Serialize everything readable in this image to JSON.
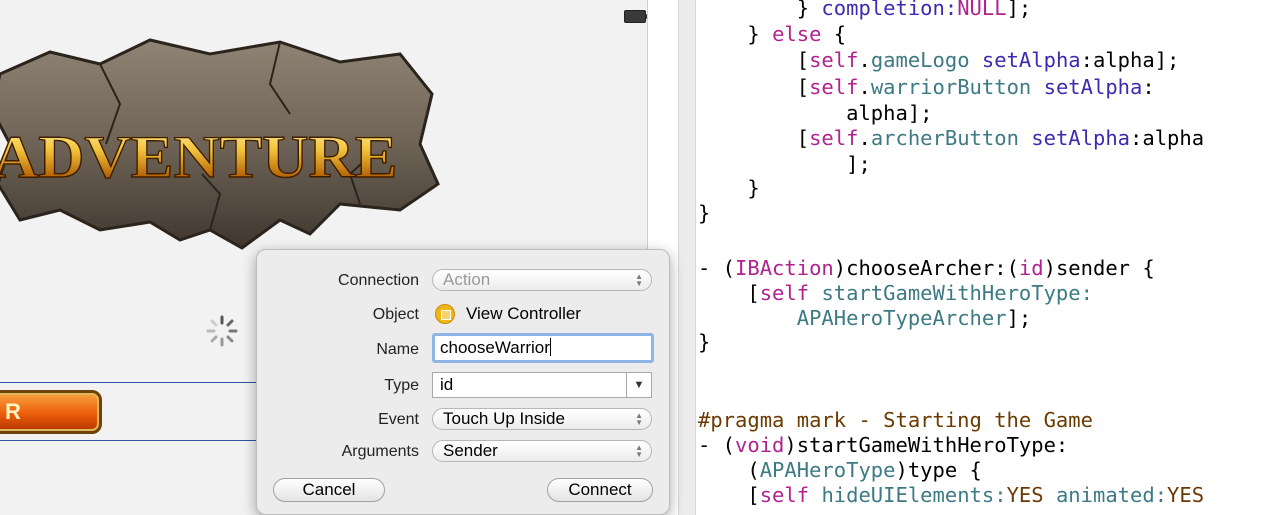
{
  "canvas": {
    "logo_text": "ADVENTURE",
    "warrior_button_label": "R"
  },
  "popover": {
    "connection": {
      "label": "Connection",
      "value": "Action"
    },
    "object": {
      "label": "Object",
      "value": "View Controller"
    },
    "name": {
      "label": "Name",
      "value": "chooseWarrior"
    },
    "type": {
      "label": "Type",
      "value": "id"
    },
    "event": {
      "label": "Event",
      "value": "Touch Up Inside"
    },
    "arguments": {
      "label": "Arguments",
      "value": "Sender"
    },
    "cancel_label": "Cancel",
    "connect_label": "Connect"
  },
  "code": {
    "l1": {
      "a": "        } ",
      "b": "completion:",
      "c": "NULL",
      "d": "];"
    },
    "l2": {
      "a": "    } ",
      "b": "else",
      "c": " {"
    },
    "l3": {
      "a": "        [",
      "b": "self",
      "c": ".",
      "d": "gameLogo",
      "e": " ",
      "f": "setAlpha",
      "g": ":alpha];"
    },
    "l4": {
      "a": "        [",
      "b": "self",
      "c": ".",
      "d": "warriorButton",
      "e": " ",
      "f": "setAlpha",
      "g": ":"
    },
    "l5": {
      "a": "            alpha];"
    },
    "l6": {
      "a": "        [",
      "b": "self",
      "c": ".",
      "d": "archerButton",
      "e": " ",
      "f": "setAlpha",
      "g": ":alpha"
    },
    "l7": {
      "a": "            ];"
    },
    "l8": {
      "a": "    }"
    },
    "l9": {
      "a": "}"
    },
    "l10": {
      "a": "- (",
      "b": "IBAction",
      "c": ")chooseArcher:(",
      "d": "id",
      "e": ")sender {"
    },
    "l11": {
      "a": "    [",
      "b": "self",
      "c": " ",
      "d": "startGameWithHeroType",
      "e": ":"
    },
    "l12": {
      "a": "        ",
      "b": "APAHeroTypeArcher",
      "c": "];"
    },
    "l13": {
      "a": "}"
    },
    "l14": {
      "a": "#pragma mark - Starting the Game"
    },
    "l15": {
      "a": "- (",
      "b": "void",
      "c": ")startGameWithHeroType:"
    },
    "l16": {
      "a": "    (",
      "b": "APAHeroType",
      "c": ")type {"
    },
    "l17": {
      "a": "    [",
      "b": "self",
      "c": " ",
      "d": "hideUIElements",
      "e": ":",
      "f": "YES",
      "g": " ",
      "h": "animated",
      "i": ":",
      "j": "YES"
    }
  },
  "colors": {
    "keyword": "#b0238f",
    "method": "#3b2bb0",
    "property": "#3d7a84",
    "macro": "#6b3a00"
  },
  "icons": [
    "battery-icon",
    "loading-spinner-icon",
    "view-controller-icon",
    "stepper-arrows-icon",
    "dropdown-arrow-icon"
  ]
}
